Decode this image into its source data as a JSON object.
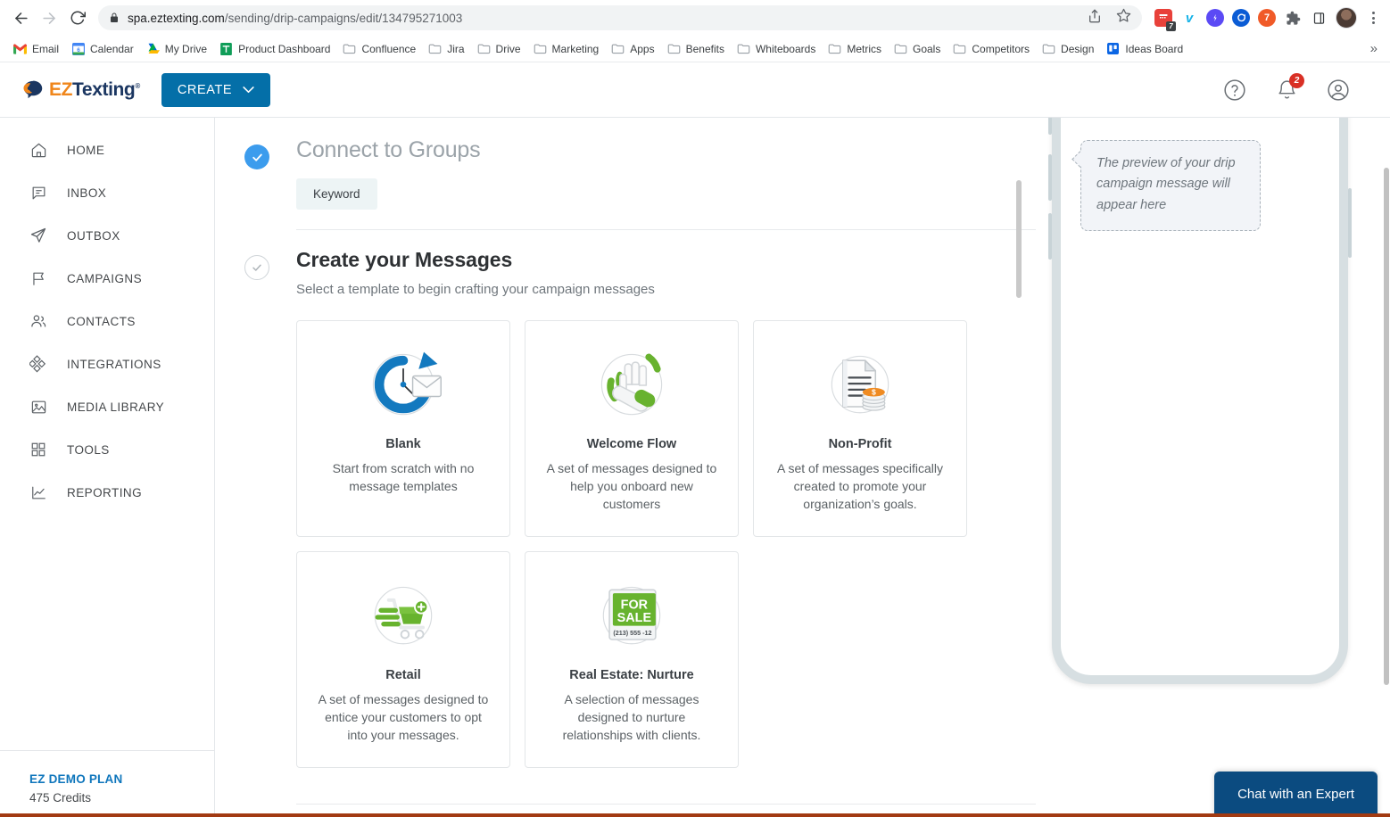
{
  "browser": {
    "url_host": "spa.eztexting.com",
    "url_path": "/sending/drip-campaigns/edit/134795271003",
    "back_icon": "back-arrow-icon",
    "forward_icon": "forward-arrow-icon",
    "reload_icon": "reload-icon",
    "lock_icon": "lock-icon",
    "share_icon": "share-icon",
    "bookmark_star_icon": "star-icon",
    "extensions": [
      {
        "name": "calendar-extension",
        "color": "#e8413a",
        "glyph": "",
        "badge": "7"
      },
      {
        "name": "vimeo-extension",
        "color": "#ffffff",
        "glyph": "v"
      },
      {
        "name": "blue-extension",
        "color": "#5b4af5",
        "glyph": ""
      },
      {
        "name": "clockify-extension",
        "color": "#0b5cd5",
        "glyph": ""
      },
      {
        "name": "toggl-extension",
        "color": "#f05a28",
        "glyph": "7"
      },
      {
        "name": "puzzle-extension",
        "color": "#5f6368",
        "glyph": ""
      },
      {
        "name": "sidepanel-extension",
        "color": "#3c4043",
        "glyph": ""
      }
    ],
    "profile_avatar": "profile-avatar",
    "menu_icon": "kebab-menu-icon",
    "bookmarks": [
      {
        "label": "Email",
        "icon": "gmail-icon"
      },
      {
        "label": "Calendar",
        "icon": "google-calendar-icon"
      },
      {
        "label": "My Drive",
        "icon": "google-drive-icon"
      },
      {
        "label": "Product Dashboard",
        "icon": "sheets-icon"
      },
      {
        "label": "Confluence",
        "icon": "folder-icon"
      },
      {
        "label": "Jira",
        "icon": "folder-icon"
      },
      {
        "label": "Drive",
        "icon": "folder-icon"
      },
      {
        "label": "Marketing",
        "icon": "folder-icon"
      },
      {
        "label": "Apps",
        "icon": "folder-icon"
      },
      {
        "label": "Benefits",
        "icon": "folder-icon"
      },
      {
        "label": "Whiteboards",
        "icon": "folder-icon"
      },
      {
        "label": "Metrics",
        "icon": "folder-icon"
      },
      {
        "label": "Goals",
        "icon": "folder-icon"
      },
      {
        "label": "Competitors",
        "icon": "folder-icon"
      },
      {
        "label": "Design",
        "icon": "folder-icon"
      },
      {
        "label": "Ideas Board",
        "icon": "trello-icon"
      }
    ],
    "bookmarks_overflow": "»"
  },
  "app_header": {
    "logo_ez": "EZ",
    "logo_texting": "Texting",
    "logo_reg": "®",
    "create_label": "CREATE",
    "create_caret_icon": "chevron-down-icon",
    "help_icon": "help-circle-icon",
    "notifications_icon": "bell-icon",
    "notifications_count": "2",
    "account_icon": "account-circle-icon"
  },
  "sidebar": {
    "items": [
      {
        "label": "HOME",
        "icon": "home-icon"
      },
      {
        "label": "INBOX",
        "icon": "inbox-message-icon"
      },
      {
        "label": "OUTBOX",
        "icon": "paper-plane-icon"
      },
      {
        "label": "CAMPAIGNS",
        "icon": "flag-icon"
      },
      {
        "label": "CONTACTS",
        "icon": "people-icon"
      },
      {
        "label": "INTEGRATIONS",
        "icon": "diamonds-icon"
      },
      {
        "label": "MEDIA LIBRARY",
        "icon": "image-icon"
      },
      {
        "label": "TOOLS",
        "icon": "grid-icon"
      },
      {
        "label": "REPORTING",
        "icon": "line-chart-icon"
      }
    ],
    "plan_name": "EZ DEMO PLAN",
    "plan_credits": "475 Credits"
  },
  "main": {
    "step_connect": {
      "title": "Connect to Groups",
      "status_icon": "check-filled-icon",
      "chip_label": "Keyword"
    },
    "step_messages": {
      "title": "Create your Messages",
      "status_icon": "check-outline-icon",
      "subtitle": "Select a template to begin crafting your campaign messages"
    },
    "templates": [
      {
        "title": "Blank",
        "description": "Start from scratch with no message templates",
        "icon": "clock-envelope-icon"
      },
      {
        "title": "Welcome Flow",
        "description": "A set of messages designed to help you onboard new customers",
        "icon": "waving-hand-icon"
      },
      {
        "title": "Non-Profit",
        "description": "A set of messages specifically created to promote your organization’s goals.",
        "icon": "document-coins-icon"
      },
      {
        "title": "Retail",
        "description": "A set of messages designed to entice your customers to opt into your messages.",
        "icon": "shopping-cart-icon"
      },
      {
        "title": "Real Estate: Nurture",
        "description": "A selection of messages designed to nurture relationships with clients.",
        "icon": "for-sale-sign-icon",
        "art_text_line1": "FOR",
        "art_text_line2": "SALE",
        "art_text_phone": "(213) 555 -12"
      }
    ]
  },
  "preview": {
    "placeholder_text": "The preview of your drip campaign message will appear here"
  },
  "chat_widget": {
    "label": "Chat with an Expert"
  },
  "colors": {
    "accent_blue": "#046fa8",
    "brand_orange": "#f0861b",
    "brand_navy": "#1b3661",
    "step_done": "#3c9ced",
    "badge_red": "#d93025",
    "chat_blue": "#0b4b80"
  }
}
